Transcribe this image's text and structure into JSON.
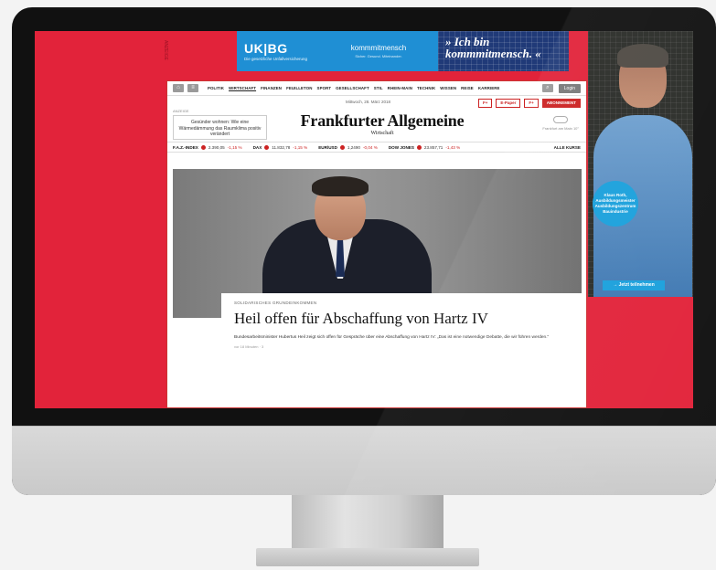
{
  "ad": {
    "vertical_label": "ANZEIGE",
    "ukbg_logo": "UK|BG",
    "ukbg_sub": "Die gesetzliche Unfallversicherung",
    "komm_logo": "kommmitmensch",
    "komm_sub": "Sicher. Gesund. Miteinander.",
    "slogan_line1": "» Ich bin",
    "slogan_line2": "kommmitmensch. «",
    "person_badge": "Klaus Roth, Ausbildungsmeister Ausbildungszentrum Bauindustrie",
    "cta": "→ Jetzt teilnehmen"
  },
  "nav": {
    "home_icon": "home-icon",
    "menu_icon": "menu-icon",
    "items": [
      "POLITIK",
      "WIRTSCHAFT",
      "FINANZEN",
      "FEUILLETON",
      "SPORT",
      "GESELLSCHAFT",
      "STIL",
      "RHEIN-MAIN",
      "TECHNIK",
      "WISSEN",
      "REISE",
      "KARRIERE"
    ],
    "active": "WIRTSCHAFT",
    "login": "Login"
  },
  "header": {
    "date": "Mittwoch, 28. März 2018",
    "anzeige": "ANZEIGE",
    "promo": "Gesünder wohnen: Wie eine Wärmedämmung das Raumklima positiv verändert",
    "masthead": "Frankfurter Allgemeine",
    "section": "Wirtschaft",
    "btn_plus": "F+",
    "btn_epaper": "E-Paper",
    "btn_plus2": "F+",
    "btn_abo": "ABONNEMENT",
    "weather": "Frankfurt am Main 10°"
  },
  "ticker": {
    "items": [
      {
        "name": "F.A.Z.-INDEX",
        "value": "2.390,05",
        "change": "-1,15 %"
      },
      {
        "name": "DAX",
        "value": "11.832,78",
        "change": "-1,15 %"
      },
      {
        "name": "EUR/USD",
        "value": "1,2490",
        "change": "-0,04 %"
      },
      {
        "name": "DOW JONES",
        "value": "23.857,71",
        "change": "-1,43 %"
      }
    ],
    "all": "ALLE KURSE"
  },
  "article": {
    "kicker": "SOLIDARISCHES GRUNDEINKOMMEN",
    "headline": "Heil offen für Abschaffung von Hartz IV",
    "teaser": "Bundesarbeitsminister Hubertus Heil zeigt sich offen für Gespräche über eine Abschaffung von Hartz IV: „Das ist eine notwendige Debatte, die wir führen werden.“",
    "meta": "vor 18 Minuten · 3"
  }
}
